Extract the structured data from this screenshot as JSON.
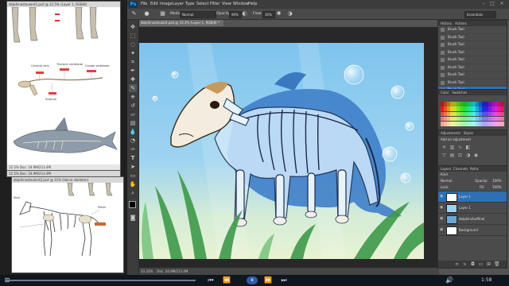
{
  "app": {
    "name": "Photoshop",
    "logo": "Ps",
    "menu": [
      "File",
      "Edit",
      "Image",
      "Layer",
      "Type",
      "Select",
      "Filter",
      "View",
      "Window",
      "Help"
    ]
  },
  "options": {
    "mode_label": "Mode:",
    "mode_value": "Normal",
    "opacity_label": "Opacity:",
    "opacity_value": "90%",
    "flow_label": "Flow:",
    "flow_value": "30%",
    "workspace_value": "Essentials"
  },
  "document": {
    "tab_title": "dolphinosteulant.psd @ 33.3% (Layer 1, RGB/8) *",
    "status_zoom": "33.33%",
    "status_doc": "Doc: 24.9M/213.4M"
  },
  "history": {
    "tabs": [
      "History",
      "Actions"
    ],
    "items": [
      "Brush Tool",
      "Brush Tool",
      "Brush Tool",
      "Brush Tool",
      "Brush Tool",
      "Brush Tool",
      "Brush Tool",
      "Brush Tool",
      "Brush Tool",
      "Brush Tool"
    ]
  },
  "swatches": {
    "tabs": [
      "Color",
      "Swatches"
    ]
  },
  "adjustments": {
    "tabs": [
      "Adjustments",
      "Styles"
    ],
    "title": "Add an adjustment"
  },
  "layers": {
    "tabs": [
      "Layers",
      "Channels",
      "Paths"
    ],
    "kind_label": "Kind",
    "blend_value": "Normal",
    "opacity_label": "Opacity:",
    "opacity_value": "100%",
    "lock_label": "Lock:",
    "fill_label": "Fill:",
    "fill_value": "100%",
    "rows": [
      "Layer 1",
      "Layer 1",
      "dolphinstudfinal",
      "Background"
    ]
  },
  "refs": {
    "top_title": "dolphinosteulant1.psd @ 12.5% (Layer 1, RGB/8)",
    "top_status": "12.5%   Doc: 24.9M/213.4M",
    "mid_status": "12.5%   Doc: 24.9M/213.4M",
    "bottom_title": "dolphinosteulant2.psd @ 21% (Horse skeleton)",
    "dolphin_labels": [
      "Cervical vert.",
      "Thoracic vertebrae",
      "Lumbar",
      "Caudal vertebrae",
      "Scapula",
      "Humerus",
      "Radius",
      "Ulna",
      "Pelvis"
    ],
    "horse_labels": [
      "Skull",
      "Cervical vertebrae",
      "Thoracic",
      "Pelvis",
      "Femur",
      "Tibia"
    ]
  },
  "taskbar": {
    "time": "1:58"
  }
}
